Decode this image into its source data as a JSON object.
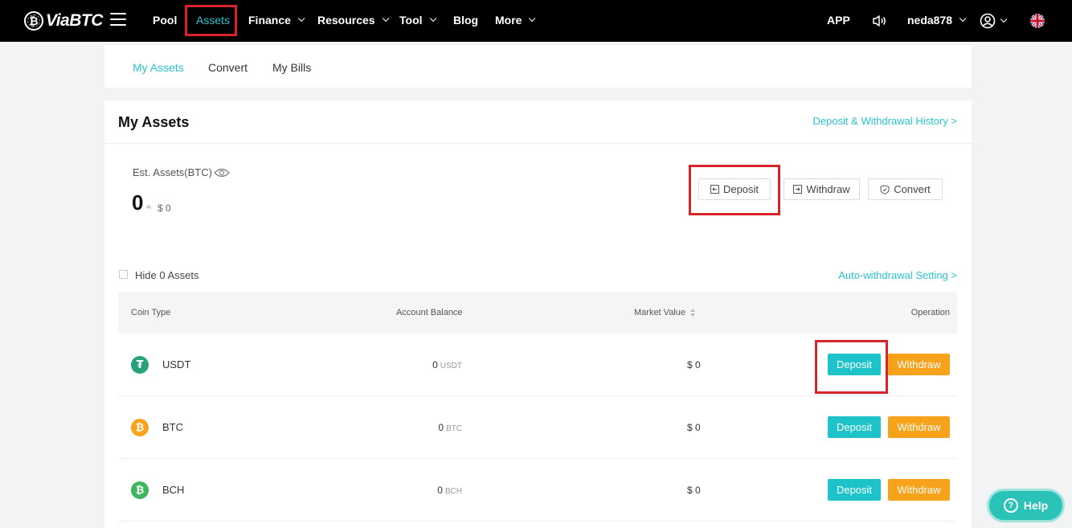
{
  "nav": {
    "logo_text": "ViaBTC",
    "logo_mark": "₿",
    "items": [
      {
        "label": "Pool",
        "dropdown": false
      },
      {
        "label": "Assets",
        "dropdown": false,
        "active": true
      },
      {
        "label": "Finance",
        "dropdown": true
      },
      {
        "label": "Resources",
        "dropdown": true
      },
      {
        "label": "Tool",
        "dropdown": true
      },
      {
        "label": "Blog",
        "dropdown": false
      },
      {
        "label": "More",
        "dropdown": true
      }
    ],
    "app_label": "APP",
    "username": "neda878",
    "language_icon": "uk-flag-icon"
  },
  "subnav": {
    "tabs": [
      "My Assets",
      "Convert",
      "My Bills"
    ],
    "active": "My Assets"
  },
  "assets": {
    "title": "My Assets",
    "history_link": "Deposit & Withdrawal History >",
    "est_label": "Est. Assets(BTC)",
    "est_value": "0",
    "approx_symbol": "≈",
    "est_usd": "$ 0",
    "actions": {
      "deposit": "Deposit",
      "withdraw": "Withdraw",
      "convert": "Convert"
    },
    "hide_zero_label": "Hide 0 Assets",
    "auto_withdrawal_link": "Auto-withdrawal Setting >"
  },
  "table": {
    "columns": {
      "coin_type": "Coin Type",
      "account_balance": "Account Balance",
      "market_value": "Market Value",
      "operation": "Operation"
    },
    "rows": [
      {
        "coin": "USDT",
        "symbol": "₮",
        "icon_color": "#26a17b",
        "balance": "0",
        "unit": "USDT",
        "market_value": "$ 0",
        "deposit": "Deposit",
        "withdraw": "Withdraw"
      },
      {
        "coin": "BTC",
        "symbol": "₿",
        "icon_color": "#f7a21b",
        "balance": "0",
        "unit": "BTC",
        "market_value": "$ 0",
        "deposit": "Deposit",
        "withdraw": "Withdraw"
      },
      {
        "coin": "BCH",
        "symbol": "₿",
        "icon_color": "#3cb55e",
        "balance": "0",
        "unit": "BCH",
        "market_value": "$ 0",
        "deposit": "Deposit",
        "withdraw": "Withdraw"
      }
    ]
  },
  "help": {
    "label": "Help"
  },
  "colors": {
    "accent": "#2bc3cf",
    "deposit_button": "#1ec3c9",
    "withdraw_button": "#f7a21b",
    "highlight_box": "#d8232a"
  }
}
